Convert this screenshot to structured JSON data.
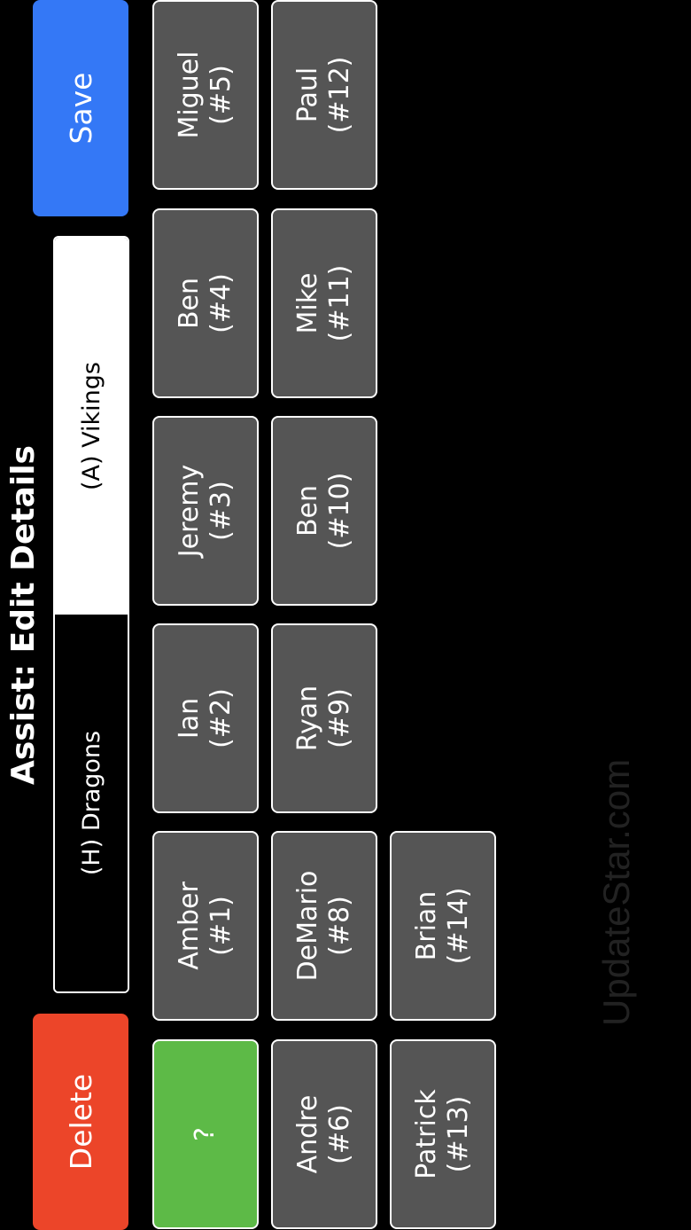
{
  "header": {
    "title": "Assist: Edit Details"
  },
  "actions": {
    "delete_label": "Delete",
    "save_label": "Save"
  },
  "team_selector": {
    "home_label": "(H) Dragons",
    "away_label": "(A) Vikings",
    "selected": "away"
  },
  "players": [
    {
      "name": "?",
      "number": "",
      "selected": true
    },
    {
      "name": "Amber",
      "number": "(#1)"
    },
    {
      "name": "Ian",
      "number": "(#2)"
    },
    {
      "name": "Jeremy",
      "number": "(#3)"
    },
    {
      "name": "Ben",
      "number": "(#4)"
    },
    {
      "name": "Miguel",
      "number": "(#5)"
    },
    {
      "name": "Andre",
      "number": "(#6)"
    },
    {
      "name": "DeMario",
      "number": "(#8)"
    },
    {
      "name": "Ryan",
      "number": "(#9)"
    },
    {
      "name": "Ben",
      "number": "(#10)"
    },
    {
      "name": "Mike",
      "number": "(#11)"
    },
    {
      "name": "Paul",
      "number": "(#12)"
    },
    {
      "name": "Patrick",
      "number": "(#13)"
    },
    {
      "name": "Brian",
      "number": "(#14)"
    }
  ],
  "watermark": "UpdateStar.com",
  "colors": {
    "delete": "#ec4529",
    "save": "#3478f6",
    "selected_player": "#5dba47",
    "tile": "#555555"
  }
}
